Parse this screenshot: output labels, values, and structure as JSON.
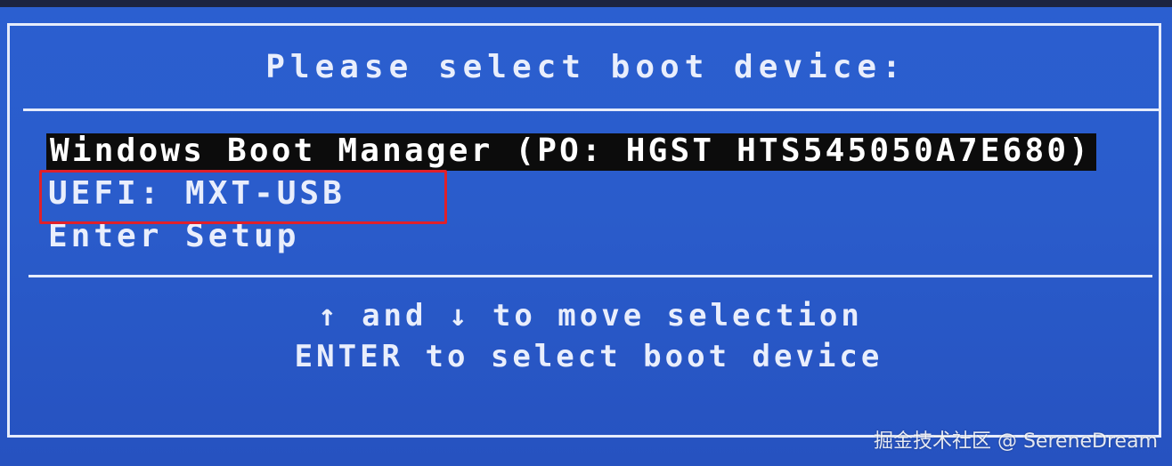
{
  "title": "Please select boot device:",
  "boot_menu": {
    "items": [
      {
        "label": "Windows Boot Manager (PO: HGST HTS545050A7E680)",
        "selected": true
      },
      {
        "label": "UEFI: MXT-USB",
        "selected": false
      },
      {
        "label": "Enter Setup",
        "selected": false
      }
    ]
  },
  "help": {
    "line1": "↑ and ↓ to move selection",
    "line2": "ENTER to select boot device"
  },
  "watermark": "掘金技术社区 @ SereneDream",
  "colors": {
    "background": "#2b5fd0",
    "text": "#e9eefc",
    "selection_background": "#0c0c0c",
    "annotation_box": "#e0202a"
  }
}
